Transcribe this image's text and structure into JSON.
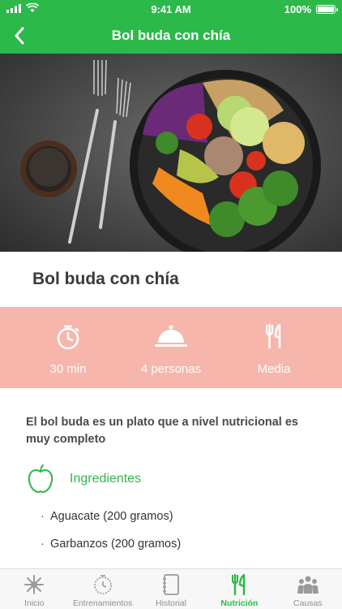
{
  "status": {
    "time": "9:41 AM",
    "battery": "100%"
  },
  "nav": {
    "title": "Bol buda con chía",
    "back_icon": "chevron-left-icon"
  },
  "recipe": {
    "title": "Bol buda con chía",
    "info": {
      "time": "30 min",
      "servings": "4 personas",
      "difficulty": "Media"
    },
    "description": "El bol buda es un plato que a nivel nutricional es muy completo",
    "ingredients_title": "Ingredientes",
    "ingredients": [
      "Aguacate (200 gramos)",
      "Garbanzos (200 gramos)"
    ]
  },
  "tabs": [
    {
      "label": "Inicio",
      "icon": "starburst-icon"
    },
    {
      "label": "Entrenamientos",
      "icon": "stopwatch-icon"
    },
    {
      "label": "Historial",
      "icon": "notebook-icon"
    },
    {
      "label": "Nutrición",
      "icon": "fork-knife-icon",
      "active": true
    },
    {
      "label": "Causas",
      "icon": "people-icon"
    }
  ],
  "colors": {
    "accent": "#2db84a",
    "info_band": "#f6b6ac"
  }
}
